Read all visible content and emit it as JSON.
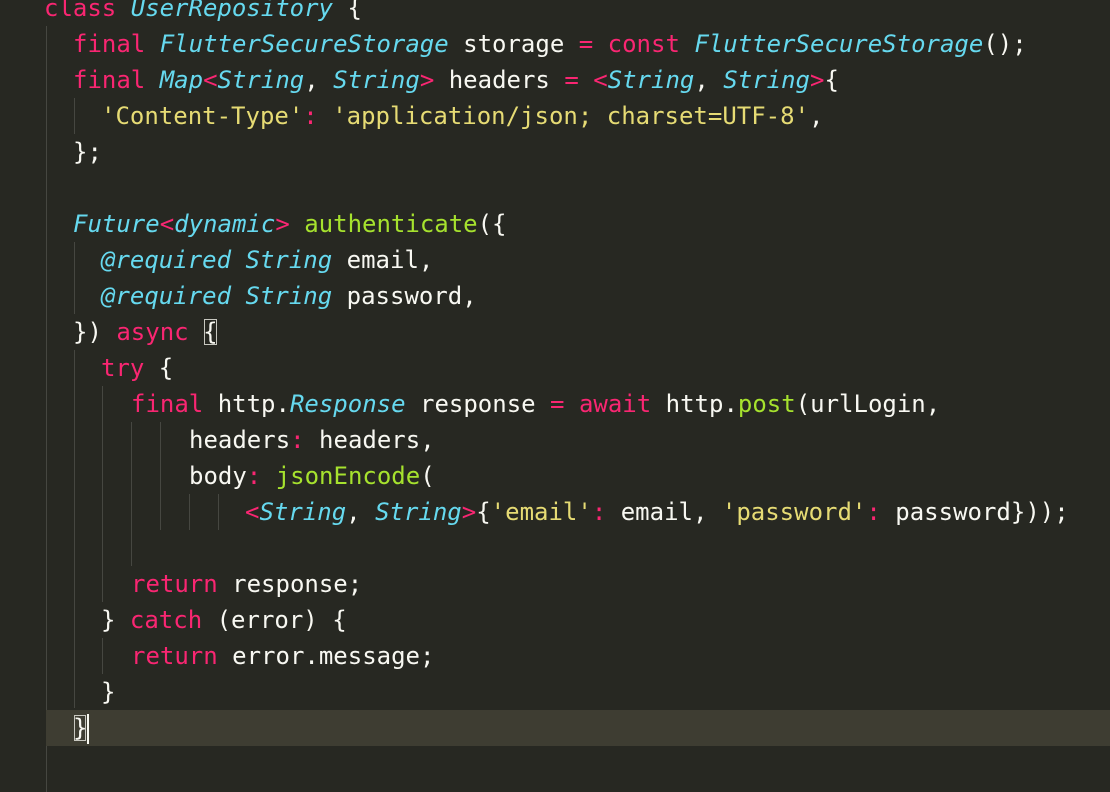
{
  "editor": {
    "language": "Dart",
    "theme_colors": {
      "background": "#272822",
      "current_line": "#3e3d32",
      "keyword": "#f92672",
      "type": "#66d9ef",
      "function": "#a6e22e",
      "string": "#e6db74",
      "plain": "#f8f8f2"
    },
    "lines": [
      {
        "tokens": [
          [
            "kw",
            "class"
          ],
          [
            "pl",
            " "
          ],
          [
            "ty",
            "UserRepository"
          ],
          [
            "pl",
            " {"
          ]
        ]
      },
      {
        "tokens": [
          [
            "kw",
            "final"
          ],
          [
            "pl",
            " "
          ],
          [
            "ty",
            "FlutterSecureStorage"
          ],
          [
            "pl",
            " storage "
          ],
          [
            "op",
            "="
          ],
          [
            "pl",
            " "
          ],
          [
            "kw",
            "const"
          ],
          [
            "pl",
            " "
          ],
          [
            "ty",
            "FlutterSecureStorage"
          ],
          [
            "pl",
            "();"
          ]
        ]
      },
      {
        "tokens": [
          [
            "kw",
            "final"
          ],
          [
            "pl",
            " "
          ],
          [
            "ty",
            "Map"
          ],
          [
            "op",
            "<"
          ],
          [
            "ty",
            "String"
          ],
          [
            "pl",
            ", "
          ],
          [
            "ty",
            "String"
          ],
          [
            "op",
            ">"
          ],
          [
            "pl",
            " headers "
          ],
          [
            "op",
            "="
          ],
          [
            "pl",
            " "
          ],
          [
            "op",
            "<"
          ],
          [
            "ty",
            "String"
          ],
          [
            "pl",
            ", "
          ],
          [
            "ty",
            "String"
          ],
          [
            "op",
            ">"
          ],
          [
            "pl",
            "{"
          ]
        ]
      },
      {
        "tokens": [
          [
            "st",
            "'Content-Type'"
          ],
          [
            "op",
            ":"
          ],
          [
            "pl",
            " "
          ],
          [
            "st",
            "'application/json; charset=UTF-8'"
          ],
          [
            "pl",
            ","
          ]
        ]
      },
      {
        "tokens": [
          [
            "pl",
            "};"
          ]
        ]
      },
      {
        "tokens": []
      },
      {
        "tokens": [
          [
            "ty",
            "Future"
          ],
          [
            "op",
            "<"
          ],
          [
            "ty",
            "dynamic"
          ],
          [
            "op",
            ">"
          ],
          [
            "pl",
            " "
          ],
          [
            "fn",
            "authenticate"
          ],
          [
            "pl",
            "({"
          ]
        ]
      },
      {
        "tokens": [
          [
            "an",
            "@required"
          ],
          [
            "pl",
            " "
          ],
          [
            "ty",
            "String"
          ],
          [
            "pl",
            " email,"
          ]
        ]
      },
      {
        "tokens": [
          [
            "an",
            "@required"
          ],
          [
            "pl",
            " "
          ],
          [
            "ty",
            "String"
          ],
          [
            "pl",
            " password,"
          ]
        ]
      },
      {
        "tokens": [
          [
            "pl",
            "}) "
          ],
          [
            "kw",
            "async"
          ],
          [
            "pl",
            " "
          ],
          [
            "pl",
            "{"
          ]
        ]
      },
      {
        "tokens": [
          [
            "kw",
            "try"
          ],
          [
            "pl",
            " {"
          ]
        ]
      },
      {
        "tokens": [
          [
            "kw",
            "final"
          ],
          [
            "pl",
            " http."
          ],
          [
            "ty",
            "Response"
          ],
          [
            "pl",
            " response "
          ],
          [
            "op",
            "="
          ],
          [
            "pl",
            " "
          ],
          [
            "kw",
            "await"
          ],
          [
            "pl",
            " http."
          ],
          [
            "fn",
            "post"
          ],
          [
            "pl",
            "(urlLogin,"
          ]
        ]
      },
      {
        "tokens": [
          [
            "pl",
            "headers"
          ],
          [
            "op",
            ":"
          ],
          [
            "pl",
            " headers,"
          ]
        ]
      },
      {
        "tokens": [
          [
            "pl",
            "body"
          ],
          [
            "op",
            ":"
          ],
          [
            "pl",
            " "
          ],
          [
            "fn",
            "jsonEncode"
          ],
          [
            "pl",
            "("
          ]
        ]
      },
      {
        "tokens": [
          [
            "op",
            "<"
          ],
          [
            "ty",
            "String"
          ],
          [
            "pl",
            ", "
          ],
          [
            "ty",
            "String"
          ],
          [
            "op",
            ">"
          ],
          [
            "pl",
            "{"
          ],
          [
            "st",
            "'email'"
          ],
          [
            "op",
            ":"
          ],
          [
            "pl",
            " email, "
          ],
          [
            "st",
            "'password'"
          ],
          [
            "op",
            ":"
          ],
          [
            "pl",
            " password}));"
          ]
        ]
      },
      {
        "tokens": []
      },
      {
        "tokens": [
          [
            "kw",
            "return"
          ],
          [
            "pl",
            " response;"
          ]
        ]
      },
      {
        "tokens": [
          [
            "pl",
            "} "
          ],
          [
            "kw",
            "catch"
          ],
          [
            "pl",
            " (error) {"
          ]
        ]
      },
      {
        "tokens": [
          [
            "kw",
            "return"
          ],
          [
            "pl",
            " error.message;"
          ]
        ]
      },
      {
        "tokens": [
          [
            "pl",
            "}"
          ]
        ]
      },
      {
        "tokens": [
          [
            "pl",
            "}"
          ]
        ]
      },
      {
        "tokens": []
      },
      {
        "tokens": []
      }
    ]
  }
}
